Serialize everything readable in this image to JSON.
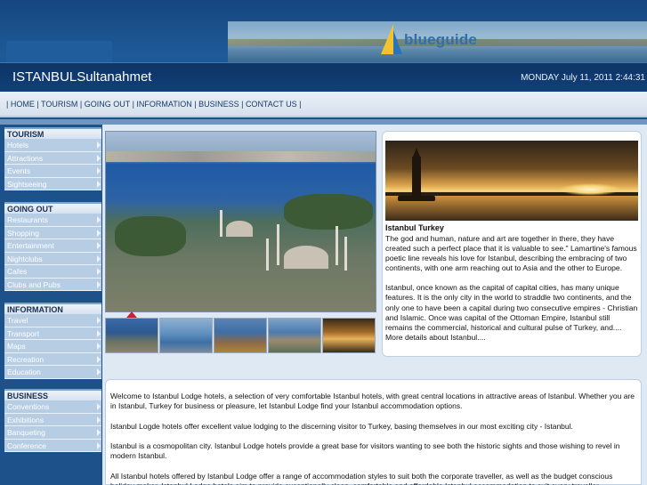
{
  "header": {
    "site_title": "ISTANBULSultanahmet",
    "datetime": "MONDAY July 11, 2011 2:44:31",
    "banner_logo": "blueguide"
  },
  "nav": {
    "items": [
      "HOME",
      "TOURISM",
      "GOING OUT",
      "INFORMATION",
      "BUSINESS",
      "CONTACT US"
    ]
  },
  "sidebar": {
    "sections": [
      {
        "title": "TOURISM",
        "items": [
          "Hotels",
          "Attractions",
          "Events",
          "Sightseeing"
        ]
      },
      {
        "title": "GOING OUT",
        "items": [
          "Restaurants",
          "Shopping",
          "Entertainment",
          "Nightclubs",
          "Cafes",
          "Clubs and Pubs"
        ]
      },
      {
        "title": "INFORMATION",
        "items": [
          "Travel",
          "Transport",
          "Maps",
          "Recreation",
          "Education"
        ]
      },
      {
        "title": "BUSINESS",
        "items": [
          "Conventions",
          "Exhibitions",
          "Banqueting",
          "Conference"
        ]
      }
    ]
  },
  "card": {
    "title": "Istanbul Turkey",
    "paragraph1": "The god and human, nature and art are together in there, they have created such a perfect place that it is valuable to see.\" Lamartine's famous poetic line reveals his love for Istanbul, describing the embracing of two continents, with one arm reaching out to Asia and the other to Europe.",
    "paragraph2": "Istanbul, once known as the capital of capital cities, has many unique features. It is the only city in the world to straddle two continents, and the only one to have been a capital during two consecutive empires - Christian and Islamic. Once was capital of the Ottoman Empire, Istanbul still remains the commercial, historical and cultural pulse of Turkey, and....",
    "more_link": "More details about Istanbul...."
  },
  "welcome": {
    "p1": "Welcome to Istanbul Lodge hotels, a selection of very comfortable Istanbul hotels, with great central locations in attractive areas of Istanbul. Whether you are in Istanbul, Turkey for business or pleasure, let Istanbul Lodge find your Istanbul accommodation options.",
    "p2": "Istanbul Logde hotels offer excellent value lodging to the discerning visitor to Turkey, basing themselves in our most exciting city - Istanbul.",
    "p3": "Istanbul is a cosmopolitan city. Istanbul Lodge hotels provide a great base for visitors wanting to see both the historic sights and those wishing to revel in modern Istanbul.",
    "p4": "All Istanbul hotels offered by Istanbul Lodge offer a range of accommodation styles to suit both the corporate traveller, as well as the budget conscious holiday maker. Istanbul Lodge hotels aim to provide exceptionally clean, comfortable and affordable Istanbul accommodation to suit every traveller."
  }
}
